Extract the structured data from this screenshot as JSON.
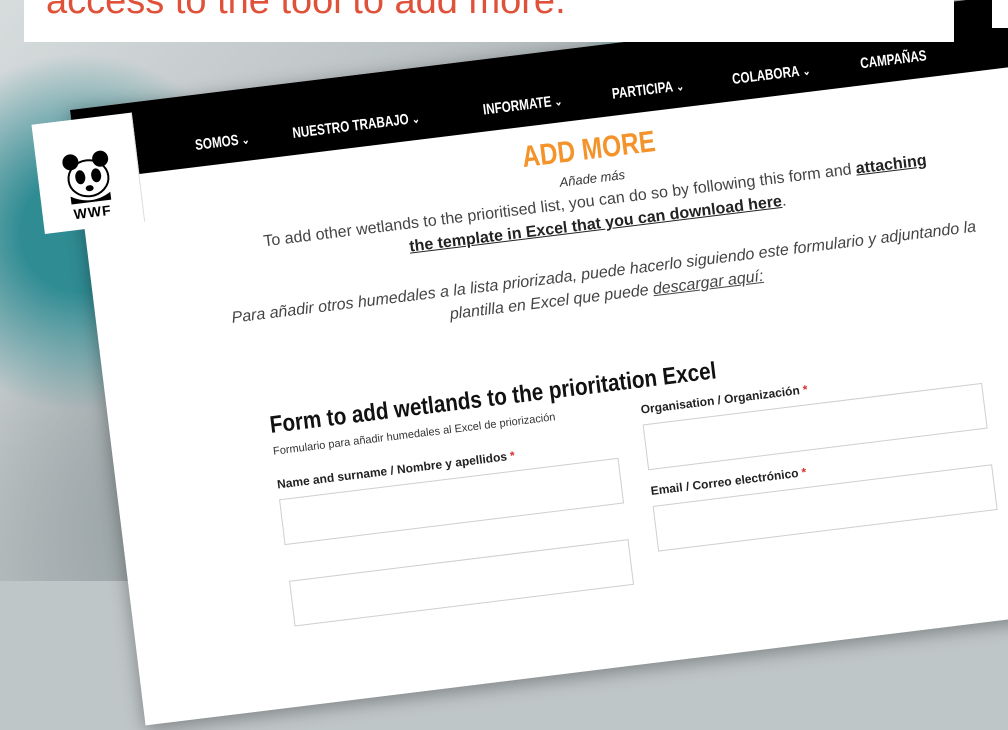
{
  "caption": {
    "text": "access to the tool to add more."
  },
  "logo": {
    "text": "WWF"
  },
  "nav": {
    "items": [
      {
        "label": "SOMOS",
        "chevron": "⌄"
      },
      {
        "label": "NUESTRO TRABAJO",
        "chevron": "⌄"
      },
      {
        "label": "INFORMATE",
        "chevron": "⌄"
      },
      {
        "label": "PARTICIPA",
        "chevron": "⌄"
      },
      {
        "label": "COLABORA",
        "chevron": "⌄"
      },
      {
        "label": "CAMPAÑAS",
        "chevron": ""
      }
    ]
  },
  "content": {
    "title": "ADD MORE",
    "subtitle": "Añade más",
    "para_en_text": "To add other wetlands to the prioritised list, you can do so by following this form and ",
    "para_en_link1": "attaching",
    "para_en_link2": "the template in Excel that you can download here",
    "para_en_end": ".",
    "para_es_text": "Para añadir otros humedales a la lista priorizada, puede hacerlo siguiendo este formulario y adjuntando la plantilla en Excel que puede ",
    "para_es_link": "descargar aquí:"
  },
  "form": {
    "title": "Form to add wetlands to the prioritation Excel",
    "subtitle": "Formulario para añadir humedales al Excel de priorización",
    "fields": {
      "name_label": "Name and surname / Nombre y apellidos",
      "org_label": "Organisation / Organización",
      "email_label": "Email / Correo electrónico",
      "required_mark": "*"
    }
  }
}
